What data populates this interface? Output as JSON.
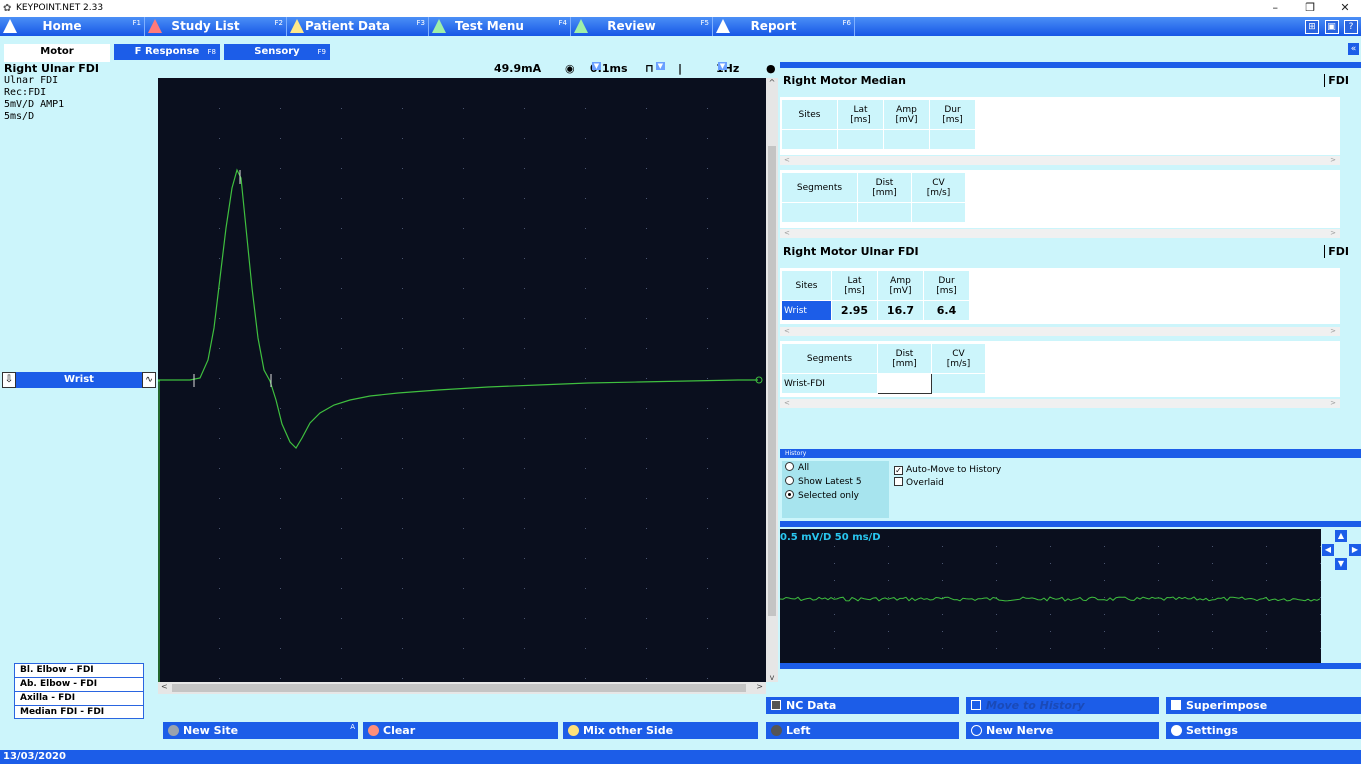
{
  "window": {
    "title": "KEYPOINT.NET 2.33",
    "minimize": "–",
    "restore": "❐",
    "close": "✕"
  },
  "menu": [
    {
      "label": "Home",
      "key": "F1"
    },
    {
      "label": "Study List",
      "key": "F2"
    },
    {
      "label": "Patient Data",
      "key": "F3"
    },
    {
      "label": "Test Menu",
      "key": "F4"
    },
    {
      "label": "Review",
      "key": "F5"
    },
    {
      "label": "Report",
      "key": "F6"
    }
  ],
  "menu_icons": [
    "⊞",
    "▣",
    "?"
  ],
  "tabs": [
    {
      "label": "Motor",
      "key": ""
    },
    {
      "label": "F Response",
      "key": "F8"
    },
    {
      "label": "Sensory",
      "key": "F9"
    }
  ],
  "nerve_info": {
    "title": "Right Ulnar FDI",
    "lines": [
      "Ulnar FDI",
      "Rec:FDI",
      "5mV/D  AMP1",
      "5ms/D"
    ]
  },
  "stim": {
    "intensity": "49.9mA",
    "duration": "0.1ms",
    "rate": "1Hz"
  },
  "current_site": "Wrist",
  "site_list": [
    "Bl. Elbow - FDI",
    "Ab. Elbow - FDI",
    "Axilla - FDI",
    "Median FDI - FDI"
  ],
  "median_panel": {
    "title": "Right Motor Median",
    "muscle": "FDI",
    "site_headers": [
      "Sites",
      "Lat\n[ms]",
      "Amp\n[mV]",
      "Dur\n[ms]"
    ],
    "segment_headers": [
      "Segments",
      "Dist\n[mm]",
      "CV\n[m/s]"
    ]
  },
  "ulnar_panel": {
    "title": "Right Motor Ulnar FDI",
    "muscle": "FDI",
    "site_headers": [
      "Sites",
      "Lat\n[ms]",
      "Amp\n[mV]",
      "Dur\n[ms]"
    ],
    "site_rows": [
      {
        "site": "Wrist",
        "lat": "2.95",
        "amp": "16.7",
        "dur": "6.4"
      }
    ],
    "segment_headers": [
      "Segments",
      "Dist\n[mm]",
      "CV\n[m/s]"
    ],
    "segment_rows": [
      {
        "segment": "Wrist-FDI",
        "dist": "",
        "cv": ""
      }
    ]
  },
  "history": {
    "title": "History",
    "options": [
      "All",
      "Show Latest 5",
      "Selected only"
    ],
    "selected": 2,
    "auto_move": "Auto-Move to History",
    "overlaid": "Overlaid"
  },
  "mini_trace_scale": "0.5 mV/D 50 ms/D",
  "buttons_right_top": [
    {
      "label": "NC Data"
    },
    {
      "label": "Move to History"
    },
    {
      "label": "Superimpose"
    }
  ],
  "buttons_bottom": [
    {
      "label": "New Site",
      "key": "A"
    },
    {
      "label": "Clear"
    },
    {
      "label": "Mix other Side"
    },
    {
      "label": "Left"
    },
    {
      "label": "New Nerve"
    },
    {
      "label": "Settings"
    }
  ],
  "status_date": "13/03/2020",
  "colors": {
    "accent": "#1c5de8",
    "background": "#ccf5fb",
    "trace": "#3fbf3f",
    "trace_bg": "#0a0f1e"
  }
}
